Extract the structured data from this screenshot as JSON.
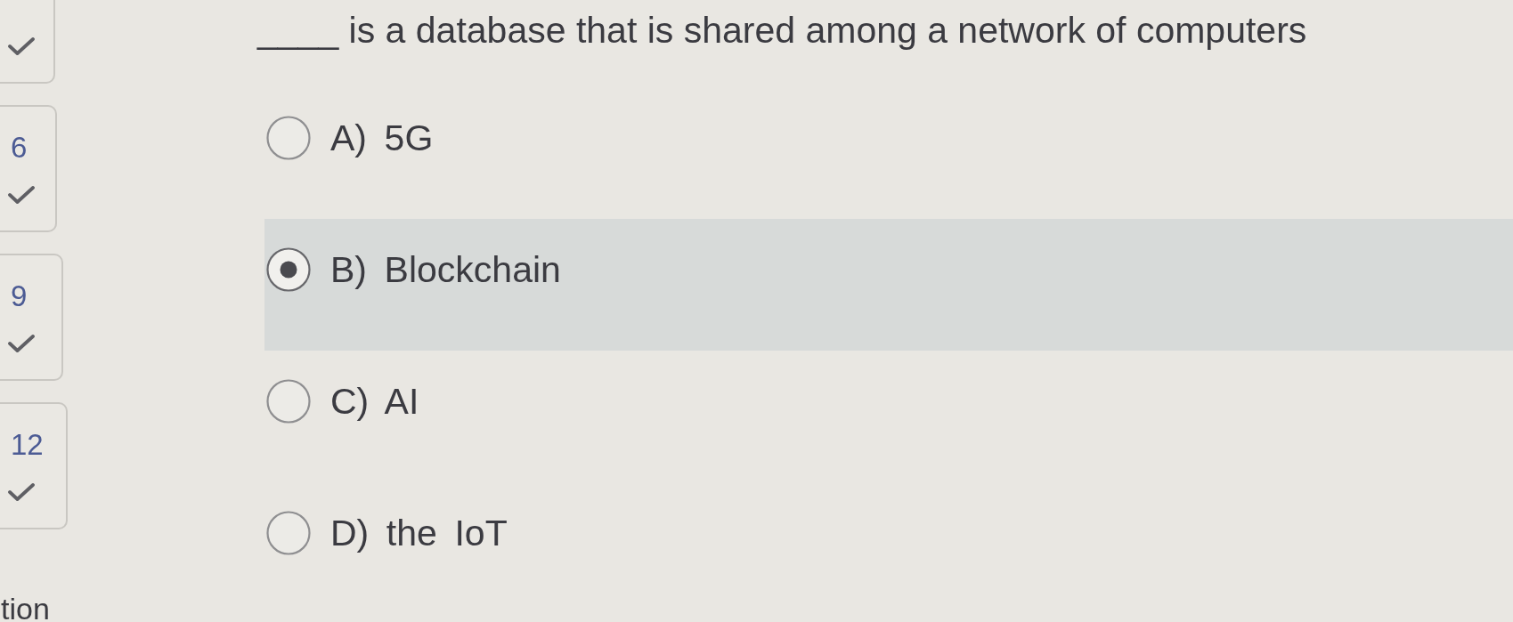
{
  "sidebar": {
    "questions": [
      {
        "answered": true
      },
      {
        "number": "6",
        "answered": true
      },
      {
        "number": "9",
        "answered": true
      },
      {
        "number": "12",
        "answered": true
      }
    ],
    "footer_text": "tion"
  },
  "question": {
    "text": "____ is a database that is shared among a network of computers"
  },
  "options": [
    {
      "label": "A) 5G",
      "selected": false
    },
    {
      "label": "B) Blockchain",
      "selected": true
    },
    {
      "label": "C) AI",
      "selected": false
    },
    {
      "label": "D) the IoT",
      "selected": false
    }
  ]
}
